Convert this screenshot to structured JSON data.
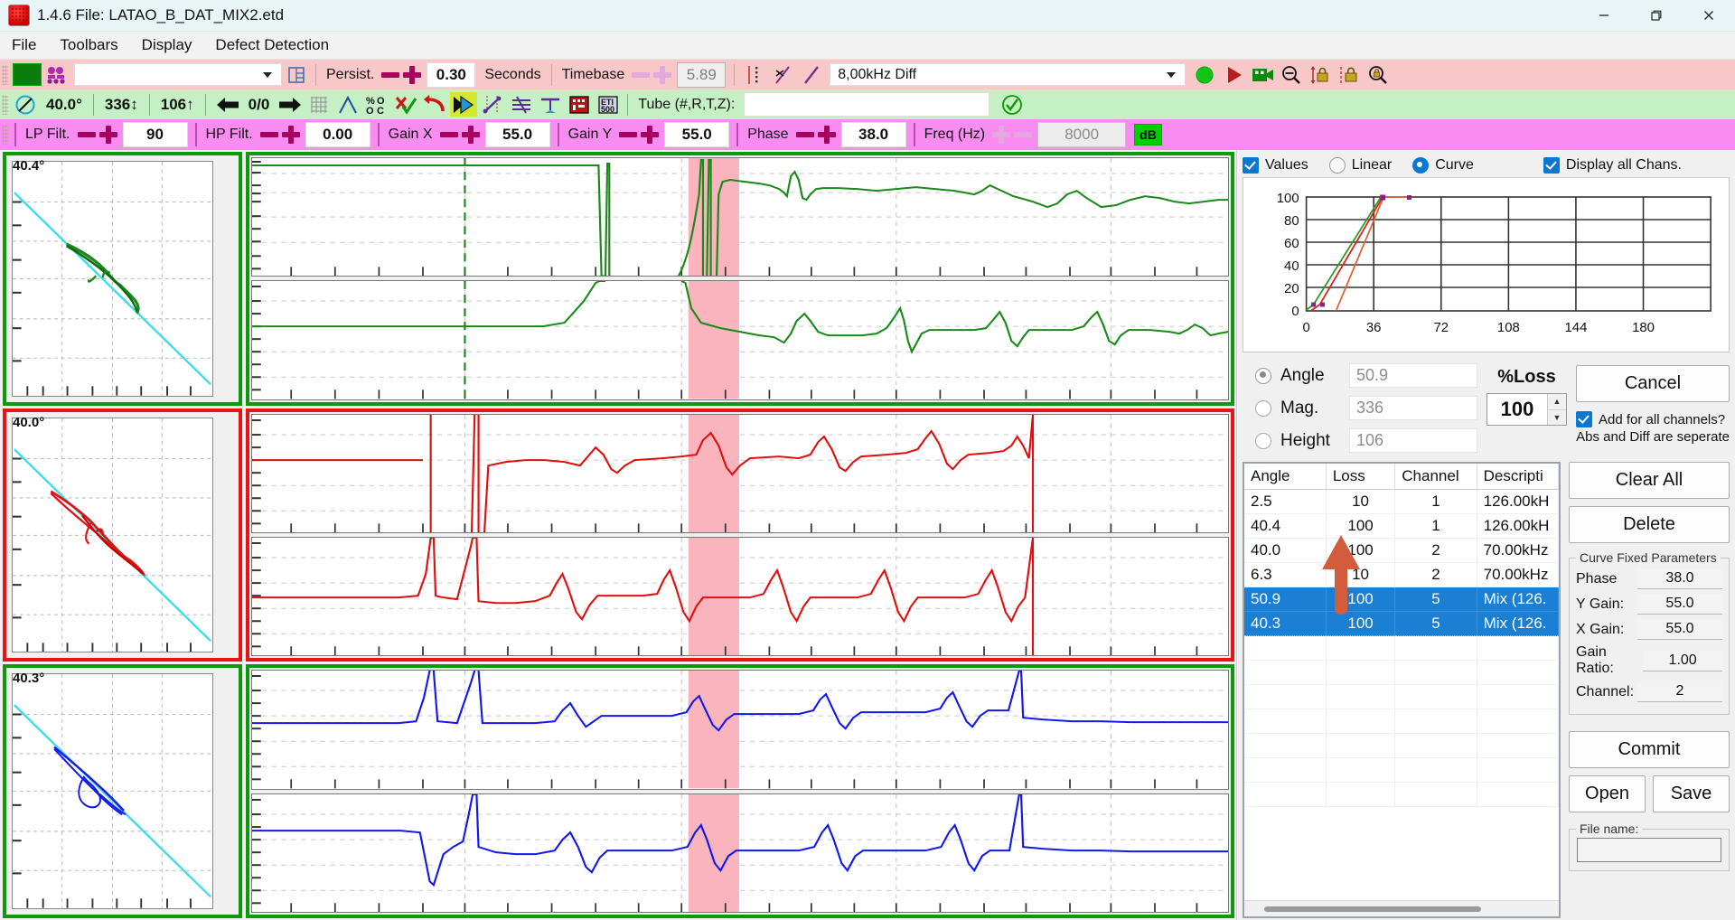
{
  "window": {
    "title": "1.4.6 File: LATAO_B_DAT_MIX2.etd",
    "icon": "app-icon",
    "minimize": "—",
    "restore": "❐",
    "close": "✕"
  },
  "menu": {
    "items": [
      {
        "label": "File"
      },
      {
        "label": "Toolbars"
      },
      {
        "label": "Display"
      },
      {
        "label": "Defect Detection"
      }
    ]
  },
  "toolbar_display": {
    "color_swatch": "#0a7d0a",
    "channel_combo_value": "",
    "persist_label": "Persist.",
    "persist_minus": "minus",
    "persist_plus": "plus",
    "persist_value": "0.30",
    "seconds_label": "Seconds",
    "timebase_label": "Timebase",
    "timebase_minus": "minus",
    "timebase_plus": "plus",
    "timebase_value": "5.89",
    "frequency_combo_value": "8,00kHz Diff"
  },
  "toolbar_analysis": {
    "angle_value": "40.0°",
    "mag_value": "336↕",
    "height_value": "106↑",
    "nav_back": "back-arrow",
    "nav_counter": "0/0",
    "nav_forward": "forward-arrow",
    "tube_label": "Tube (#,R,T,Z):",
    "tube_value": ""
  },
  "toolbar_filters": {
    "lp_label": "LP Filt.",
    "lp_value": "90",
    "hp_label": "HP Filt.",
    "hp_value": "0.00",
    "gainx_label": "Gain X",
    "gainx_value": "55.0",
    "gainy_label": "Gain Y",
    "gainy_value": "55.0",
    "phase_label": "Phase",
    "phase_value": "38.0",
    "freq_label": "Freq (Hz)",
    "freq_value": "8000",
    "db_label": "dB"
  },
  "channels": [
    {
      "name": "channel-1",
      "color": "#1a8a1a",
      "border": "#0a9a0a",
      "angle": "40.4°"
    },
    {
      "name": "channel-2",
      "color": "#e01010",
      "border": "#e81313",
      "angle": "40.0°"
    },
    {
      "name": "channel-3",
      "color": "#1418e8",
      "border": "#0a9a0a",
      "angle": "40.3°"
    }
  ],
  "curve_panel": {
    "values_checkbox": {
      "label": "Values",
      "checked": true
    },
    "linear_radio": {
      "label": "Linear",
      "selected": false
    },
    "curve_radio": {
      "label": "Curve",
      "selected": true
    },
    "display_all_chans": {
      "label": "Display all Chans.",
      "checked": true
    },
    "mode_radios": [
      {
        "label": "Angle",
        "selected": true,
        "value": "50.9"
      },
      {
        "label": "Mag.",
        "selected": false,
        "value": "336"
      },
      {
        "label": "Height",
        "selected": false,
        "value": "106"
      }
    ],
    "loss_label": "%Loss",
    "loss_value": "100",
    "spin_up": "▲",
    "spin_down": "▼",
    "cancel_button": "Cancel",
    "add_all_channels": {
      "label": "Add for all channels?",
      "checked": true
    },
    "abs_diff_note": "Abs and Diff are seperate",
    "clear_all_button": "Clear All",
    "delete_button": "Delete",
    "commit_button": "Commit",
    "open_button": "Open",
    "save_button": "Save",
    "file_name_label": "File name:",
    "file_name_value": ""
  },
  "fixed_params": {
    "group_title": "Curve Fixed Parameters",
    "rows": [
      {
        "label": "Phase",
        "value": "38.0"
      },
      {
        "label": "Y Gain:",
        "value": "55.0"
      },
      {
        "label": "X Gain:",
        "value": "55.0"
      },
      {
        "label": "Gain Ratio:",
        "value": "1.00"
      },
      {
        "label": "Channel:",
        "value": "2"
      }
    ]
  },
  "curve_table": {
    "columns": [
      "Angle",
      "Loss",
      "Channel",
      "Descripti"
    ],
    "rows": [
      {
        "angle": "2.5",
        "loss": "10",
        "channel": "1",
        "description": "126.00kH",
        "selected": false
      },
      {
        "angle": "40.4",
        "loss": "100",
        "channel": "1",
        "description": "126.00kH",
        "selected": false
      },
      {
        "angle": "40.0",
        "loss": "100",
        "channel": "2",
        "description": "70.00kHz",
        "selected": false
      },
      {
        "angle": "6.3",
        "loss": "10",
        "channel": "2",
        "description": "70.00kHz",
        "selected": false
      },
      {
        "angle": "50.9",
        "loss": "100",
        "channel": "5",
        "description": "Mix (126.",
        "selected": true
      },
      {
        "angle": "40.3",
        "loss": "100",
        "channel": "5",
        "description": "Mix (126.",
        "selected": true
      }
    ]
  },
  "annotation": {
    "arrow_color": "#d25c3c",
    "arrow_name": "orange-up-arrow"
  },
  "chart_data": {
    "type": "line",
    "title": "",
    "xlabel": "",
    "ylabel": "",
    "xlim": [
      0,
      180
    ],
    "ylim": [
      0,
      100
    ],
    "xticks": [
      0,
      36,
      72,
      108,
      144,
      180
    ],
    "yticks": [
      0,
      20,
      40,
      60,
      80,
      100
    ],
    "grid": true,
    "legend": "none",
    "series": [
      {
        "name": "channel-1-green",
        "color": "#2d9b2d",
        "x": [
          0,
          3,
          40
        ],
        "y": [
          5,
          10,
          100
        ]
      },
      {
        "name": "channel-2-red",
        "color": "#e02020",
        "x": [
          2,
          6,
          40,
          41
        ],
        "y": [
          0,
          10,
          100,
          100
        ]
      },
      {
        "name": "channel-5-mix",
        "color": "#e0633a",
        "x": [
          13,
          40,
          52
        ],
        "y": [
          0,
          100,
          100
        ]
      }
    ],
    "markers": [
      {
        "x": 3,
        "y": 10,
        "color": "#8b1f8b"
      },
      {
        "x": 6,
        "y": 10,
        "color": "#8b1f8b"
      },
      {
        "x": 40,
        "y": 100,
        "color": "#8b1f8b"
      },
      {
        "x": 52,
        "y": 100,
        "color": "#8b1f8b"
      }
    ]
  }
}
